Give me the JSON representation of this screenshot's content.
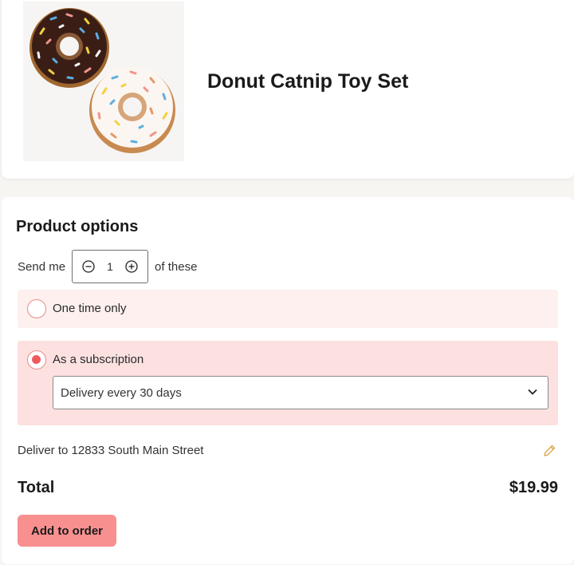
{
  "product": {
    "title": "Donut Catnip Toy Set",
    "image_icon": "donut-toys-image"
  },
  "options": {
    "section_title": "Product options",
    "quantity": {
      "prefix": "Send me",
      "value": "1",
      "suffix": "of these"
    },
    "purchase_types": [
      {
        "label": "One time only",
        "selected": false
      },
      {
        "label": "As a subscription",
        "selected": true
      }
    ],
    "frequency_select": {
      "value": "Delivery every 30 days"
    },
    "delivery": {
      "text": "Deliver to 12833 South Main Street"
    },
    "total": {
      "label": "Total",
      "value": "$19.99"
    },
    "add_button": "Add to order"
  },
  "colors": {
    "accent": "#f99090",
    "radio_selected": "#ef5a60",
    "once_bg": "#fdf0ef",
    "sub_bg": "#fde1e1",
    "edit_icon": "#d9a648"
  }
}
